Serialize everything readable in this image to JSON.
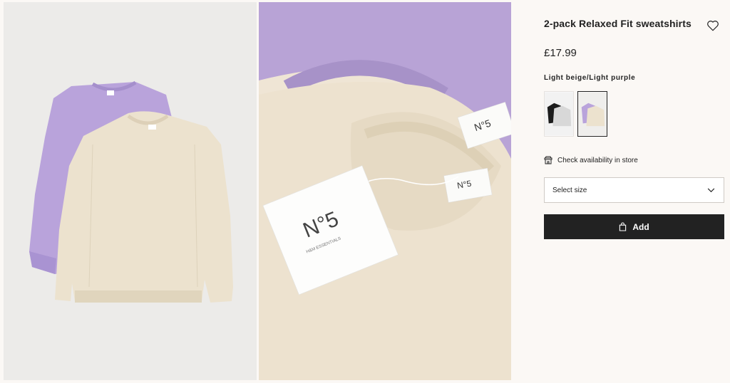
{
  "product": {
    "title": "2-pack Relaxed Fit sweatshirts",
    "price": "£17.99",
    "color_name": "Light beige/Light purple",
    "swatches": [
      {
        "label": "Black/Light grey",
        "selected": false
      },
      {
        "label": "Light beige/Light purple",
        "selected": true
      }
    ]
  },
  "store": {
    "label": "Check availability in store"
  },
  "size": {
    "placeholder": "Select size"
  },
  "add": {
    "label": "Add"
  },
  "tag": {
    "brand": "N°5",
    "line": "H&M ESSENTIALS"
  },
  "colors": {
    "purple": "#b7a2d9",
    "beige": "#eadfca",
    "dark": "#222222",
    "grey": "#d9d9d9"
  }
}
